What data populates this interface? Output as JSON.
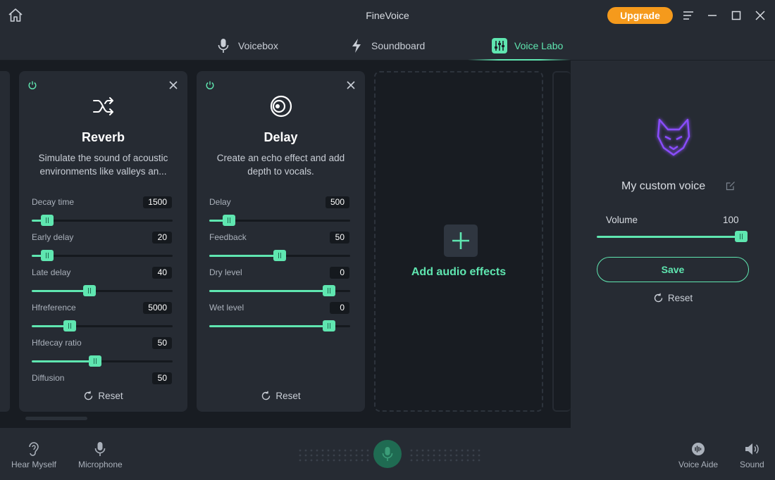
{
  "app": {
    "title": "FineVoice",
    "upgrade_label": "Upgrade"
  },
  "tabs": [
    {
      "label": "Voicebox",
      "icon": "microphone-icon",
      "active": false
    },
    {
      "label": "Soundboard",
      "icon": "lightning-icon",
      "active": false
    },
    {
      "label": "Voice Labo",
      "icon": "sliders-icon",
      "active": true
    }
  ],
  "effects": [
    {
      "title": "Reverb",
      "icon": "shuffle-icon",
      "description": "Simulate the sound of acoustic environments like valleys an...",
      "params": [
        {
          "label": "Decay time",
          "value": "1500",
          "level": 0.11
        },
        {
          "label": "Early delay",
          "value": "20",
          "level": 0.11
        },
        {
          "label": "Late delay",
          "value": "40",
          "level": 0.41
        },
        {
          "label": "Hfreference",
          "value": "5000",
          "level": 0.27
        },
        {
          "label": "Hfdecay ratio",
          "value": "50",
          "level": 0.45
        },
        {
          "label": "Diffusion",
          "value": "50",
          "level": null
        }
      ],
      "reset_label": "Reset"
    },
    {
      "title": "Delay",
      "icon": "echo-rings-icon",
      "description": "Create an echo effect and add depth to vocals.",
      "params": [
        {
          "label": "Delay",
          "value": "500",
          "level": 0.14
        },
        {
          "label": "Feedback",
          "value": "50",
          "level": 0.5
        },
        {
          "label": "Dry level",
          "value": "0",
          "level": 0.85
        },
        {
          "label": "Wet level",
          "value": "0",
          "level": 0.85
        }
      ],
      "reset_label": "Reset"
    }
  ],
  "add_effects_label": "Add audio effects",
  "right_panel": {
    "voice_name": "My custom voice",
    "volume_label": "Volume",
    "volume_value": "100",
    "volume_level": 0.96,
    "save_label": "Save",
    "reset_label": "Reset"
  },
  "bottom": {
    "hear_myself": "Hear Myself",
    "microphone": "Microphone",
    "voice_aide": "Voice Aide",
    "sound": "Sound"
  },
  "colors": {
    "accent": "#5fe6b0",
    "upgrade": "#f59a1c",
    "avatar": "#8a4dff"
  }
}
